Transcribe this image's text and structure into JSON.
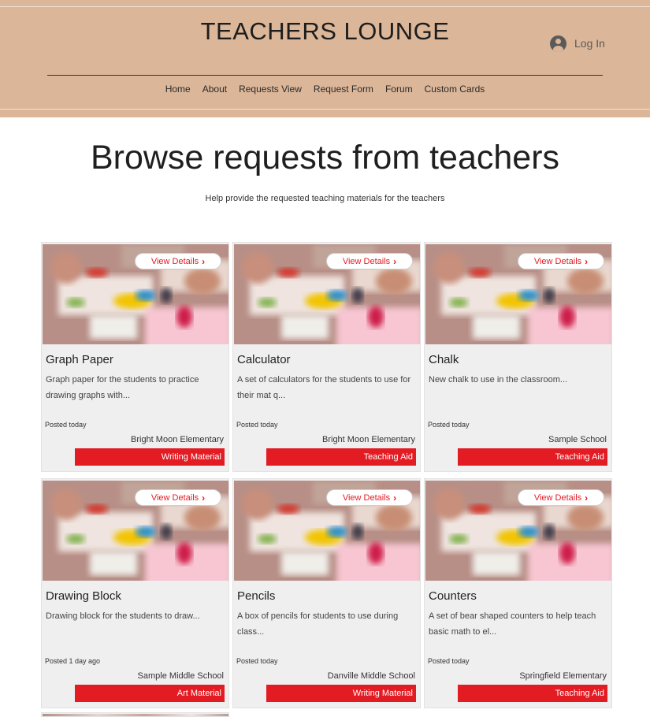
{
  "header": {
    "site_title": "TEACHERS LOUNGE",
    "login_label": "Log In",
    "nav": [
      "Home",
      "About",
      "Requests View",
      "Request Form",
      "Forum",
      "Custom Cards"
    ]
  },
  "hero": {
    "title": "Browse requests from teachers",
    "subtitle": "Help provide the requested teaching materials for the teachers"
  },
  "cards": [
    {
      "button_label": "View Details",
      "title": "Graph Paper",
      "desc": "Graph paper for the students to practice drawing graphs with...",
      "posted": "Posted today",
      "school": "Bright Moon Elementary",
      "tag": "Writing Material"
    },
    {
      "button_label": "View Details",
      "title": "Calculator",
      "desc": "A set of calculators for the students to use for their mat q...",
      "posted": "Posted today",
      "school": "Bright Moon Elementary",
      "tag": "Teaching Aid"
    },
    {
      "button_label": "View Details",
      "title": "Chalk",
      "desc": "New chalk to use in the classroom...",
      "posted": "Posted today",
      "school": "Sample School",
      "tag": "Teaching Aid"
    },
    {
      "button_label": "View Details",
      "title": "Drawing Block",
      "desc": "Drawing block for the students to draw...",
      "posted": "Posted 1 day ago",
      "school": "Sample Middle School",
      "tag": "Art Material"
    },
    {
      "button_label": "View Details",
      "title": "Pencils",
      "desc": "A box of pencils for students to use during class...",
      "posted": "Posted today",
      "school": "Danville Middle School",
      "tag": "Writing Material"
    },
    {
      "button_label": "View Details",
      "title": "Counters",
      "desc": "A set of bear shaped counters to help teach basic math to el...",
      "posted": "Posted today",
      "school": "Springfield Elementary",
      "tag": "Teaching Aid"
    }
  ],
  "colors": {
    "header_bg": "#dcb698",
    "accent_red": "#e31b23",
    "card_bg": "#efefef"
  },
  "icons": {
    "login": "user-avatar-icon",
    "view_details": "chevron-right-icon"
  }
}
